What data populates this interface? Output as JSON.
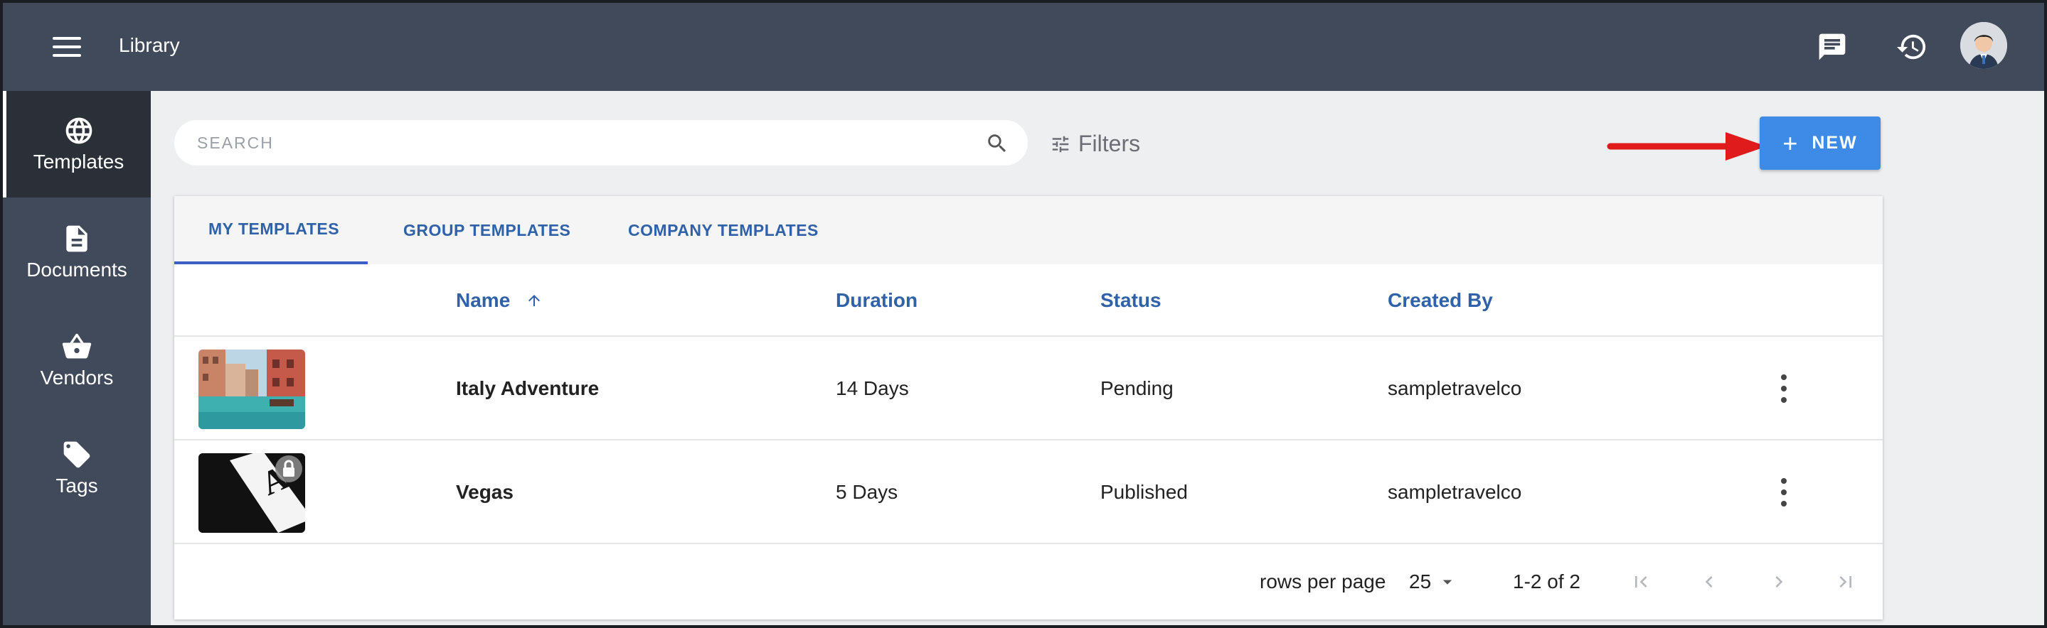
{
  "header": {
    "title": "Library"
  },
  "sidebar": {
    "items": [
      {
        "label": "Templates",
        "icon": "globe-icon",
        "active": true
      },
      {
        "label": "Documents",
        "icon": "document-icon"
      },
      {
        "label": "Vendors",
        "icon": "basket-icon"
      },
      {
        "label": "Tags",
        "icon": "tag-icon"
      }
    ]
  },
  "search": {
    "placeholder": "SEARCH",
    "value": ""
  },
  "filters": {
    "label": "Filters"
  },
  "new_button": {
    "label": "NEW"
  },
  "tabs": [
    {
      "label": "MY TEMPLATES",
      "active": true
    },
    {
      "label": "GROUP TEMPLATES"
    },
    {
      "label": "COMPANY TEMPLATES"
    }
  ],
  "table": {
    "columns": [
      "Name",
      "Duration",
      "Status",
      "Created By"
    ],
    "rows": [
      {
        "name": "Italy Adventure",
        "duration": "14 Days",
        "status": "Pending",
        "created_by": "sampletravelco"
      },
      {
        "name": "Vegas",
        "duration": "5 Days",
        "status": "Published",
        "created_by": "sampletravelco"
      }
    ]
  },
  "pagination": {
    "rows_per_page_label": "rows per page",
    "rows_per_page": "25",
    "range": "1-2 of 2"
  },
  "colors": {
    "topbar": "#414a5b",
    "accent": "#3d8be6",
    "header_text": "#2f62a8",
    "annotation_arrow": "#e01b1b"
  }
}
